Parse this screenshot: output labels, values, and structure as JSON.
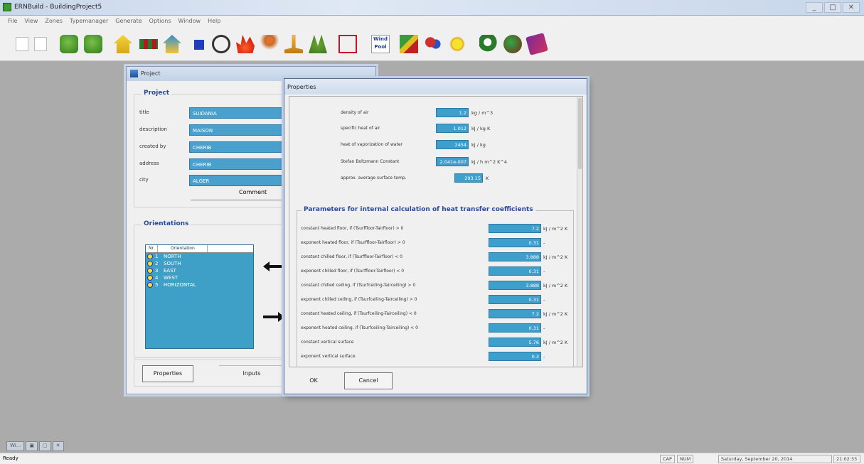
{
  "window": {
    "title": "ERNBuild - BuildingProject5",
    "btn_min": "_",
    "btn_max": "□",
    "btn_close": "✕"
  },
  "menu": [
    "File",
    "View",
    "Zones",
    "Typemanager",
    "Generate",
    "Options",
    "Window",
    "Help"
  ],
  "toolbar": {
    "icons": [
      "new-file-icon",
      "open-file-icon",
      "tree-icon",
      "tree2-icon",
      "house-icon",
      "wall-icon",
      "house-color-icon",
      "blue-square-icon",
      "fan-icon",
      "fire-icon",
      "person-icon",
      "lamp-icon",
      "plant-icon",
      "graph-icon",
      "windpool-icon",
      "chart-icon",
      "people-icon",
      "sun-icon",
      "info-icon",
      "globe-icon",
      "book-icon"
    ],
    "windpool_label": "Wind Pool"
  },
  "project_window": {
    "title": "Project",
    "group_project": "Project",
    "fields": [
      {
        "label": "title",
        "value": "SUIDANIA"
      },
      {
        "label": "description",
        "value": "MAISON"
      },
      {
        "label": "created by",
        "value": "CHERIB"
      },
      {
        "label": "address",
        "value": "CHERIB"
      },
      {
        "label": "city",
        "value": "ALGER"
      }
    ],
    "comment_button": "Comment",
    "group_orientations": "Orientations",
    "orient_columns": [
      "Nr.",
      "Orientation"
    ],
    "orientations": [
      {
        "nr": "1",
        "name": "NORTH"
      },
      {
        "nr": "2",
        "name": "SOUTH"
      },
      {
        "nr": "3",
        "name": "EAST"
      },
      {
        "nr": "4",
        "name": "WEST"
      },
      {
        "nr": "5",
        "name": "HORIZONTAL"
      }
    ],
    "properties_button": "Properties",
    "inputs_button": "Inputs"
  },
  "properties_dialog": {
    "title": "Properties",
    "top_params": [
      {
        "label": "density of air",
        "value": "1.2",
        "unit": "kg / m^3"
      },
      {
        "label": "specific heat of air",
        "value": "1.012",
        "unit": "kJ / kg K"
      },
      {
        "label": "heat of vaporization of water",
        "value": "2454",
        "unit": "kJ / kg"
      },
      {
        "label": "Stefan Boltzmann Constant",
        "value": "2.041e-007",
        "unit": "kJ / h m^2 K^4"
      },
      {
        "label": "approx. average surface temp.",
        "value": "293.15",
        "unit": "K"
      }
    ],
    "group_title": "Parameters for internal calculation of heat transfer coefficients",
    "coeffs": [
      {
        "label": "constant heated floor, if (Tsurffloor-Tairfloor) > 0",
        "value": "7.2",
        "unit": "kJ / m^2 K"
      },
      {
        "label": "exponent heated floor, if (Tsurffloor-Tairfloor) > 0",
        "value": "0.31",
        "unit": "-"
      },
      {
        "label": "constant chilled floor, if (Tsurffloor-Tairfloor) < 0",
        "value": "3.888",
        "unit": "kJ / m^2 K"
      },
      {
        "label": "exponent chilled floor, if (Tsurffloor-Tairfloor) < 0",
        "value": "0.31",
        "unit": "-"
      },
      {
        "label": "constant chilled ceiling, if (Tsurfceiling-Tairceiling) > 0",
        "value": "3.888",
        "unit": "kJ / m^2 K"
      },
      {
        "label": "exponent chilled ceiling, if (Tsurfceiling-Tairceiling) > 0",
        "value": "0.31",
        "unit": "-"
      },
      {
        "label": "constant heated ceiling, if (Tsurfceiling-Tairceiling) < 0",
        "value": "7.2",
        "unit": "kJ / m^2 K"
      },
      {
        "label": "exponent heated ceiling, if (Tsurfceiling-Tairceiling) < 0",
        "value": "0.31",
        "unit": "-"
      },
      {
        "label": "constant vertical surface",
        "value": "5.76",
        "unit": "kJ / m^2 K"
      },
      {
        "label": "exponent vertical surface",
        "value": "0.3",
        "unit": "-"
      }
    ],
    "ok_button": "OK",
    "cancel_button": "Cancel"
  },
  "mdi_tabs": [
    "Wi...",
    "▣",
    "▢",
    "✕"
  ],
  "status": {
    "ready": "Ready",
    "caps": "CAP",
    "num": "NUM",
    "datetime": "Saturday, September 20, 2014",
    "time": "21:02:33"
  }
}
